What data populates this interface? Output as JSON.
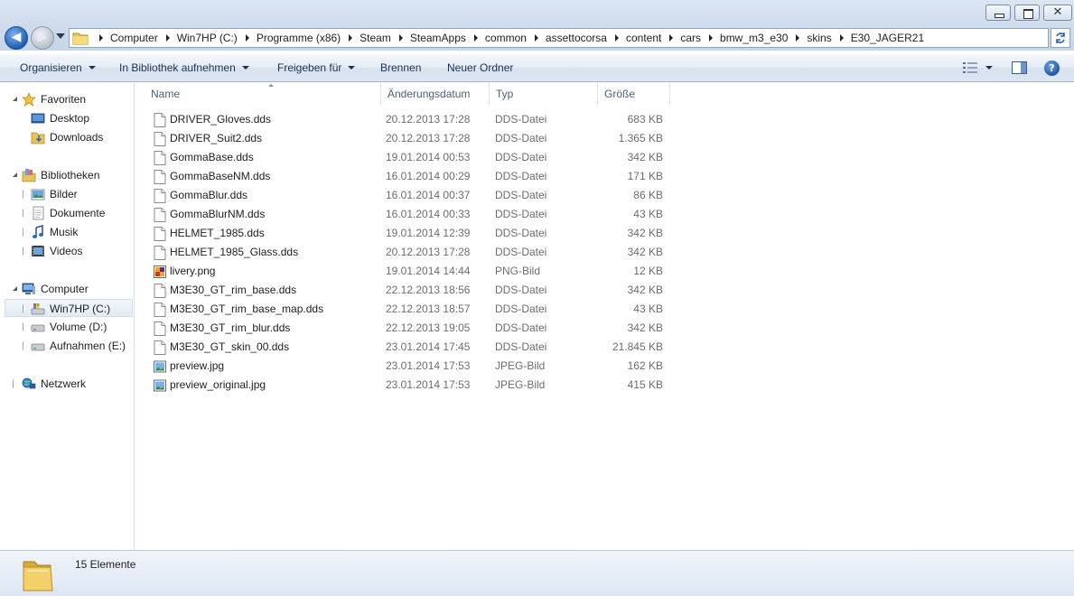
{
  "titlebar": {
    "minimize_icon": "minimize-icon",
    "maximize_icon": "maximize-icon",
    "close_glyph": "✕"
  },
  "address": {
    "crumbs": [
      "Computer",
      "Win7HP (C:)",
      "Programme (x86)",
      "Steam",
      "SteamApps",
      "common",
      "assettocorsa",
      "content",
      "cars",
      "bmw_m3_e30",
      "skins",
      "E30_JAGER21"
    ]
  },
  "toolbar": {
    "organize": "Organisieren",
    "include_library": "In Bibliothek aufnehmen",
    "share": "Freigeben für",
    "burn": "Brennen",
    "new_folder": "Neuer Ordner",
    "help_glyph": "?"
  },
  "nav": {
    "favorites": "Favoriten",
    "desktop": "Desktop",
    "downloads": "Downloads",
    "libraries": "Bibliotheken",
    "pictures": "Bilder",
    "documents": "Dokumente",
    "music": "Musik",
    "videos": "Videos",
    "computer": "Computer",
    "drive_c": "Win7HP (C:)",
    "drive_d": "Volume (D:)",
    "drive_e": "Aufnahmen (E:)",
    "network": "Netzwerk"
  },
  "columns": {
    "name": "Name",
    "date": "Änderungsdatum",
    "type": "Typ",
    "size": "Größe"
  },
  "files": [
    {
      "name": "DRIVER_Gloves.dds",
      "date": "20.12.2013 17:28",
      "type": "DDS-Datei",
      "size": "683 KB",
      "icon": "dds"
    },
    {
      "name": "DRIVER_Suit2.dds",
      "date": "20.12.2013 17:28",
      "type": "DDS-Datei",
      "size": "1.365 KB",
      "icon": "dds"
    },
    {
      "name": "GommaBase.dds",
      "date": "19.01.2014 00:53",
      "type": "DDS-Datei",
      "size": "342 KB",
      "icon": "dds"
    },
    {
      "name": "GommaBaseNM.dds",
      "date": "16.01.2014 00:29",
      "type": "DDS-Datei",
      "size": "171 KB",
      "icon": "dds"
    },
    {
      "name": "GommaBlur.dds",
      "date": "16.01.2014 00:37",
      "type": "DDS-Datei",
      "size": "86 KB",
      "icon": "dds"
    },
    {
      "name": "GommaBlurNM.dds",
      "date": "16.01.2014 00:33",
      "type": "DDS-Datei",
      "size": "43 KB",
      "icon": "dds"
    },
    {
      "name": "HELMET_1985.dds",
      "date": "19.01.2014 12:39",
      "type": "DDS-Datei",
      "size": "342 KB",
      "icon": "dds"
    },
    {
      "name": "HELMET_1985_Glass.dds",
      "date": "20.12.2013 17:28",
      "type": "DDS-Datei",
      "size": "342 KB",
      "icon": "dds"
    },
    {
      "name": "livery.png",
      "date": "19.01.2014 14:44",
      "type": "PNG-Bild",
      "size": "12 KB",
      "icon": "png"
    },
    {
      "name": "M3E30_GT_rim_base.dds",
      "date": "22.12.2013 18:56",
      "type": "DDS-Datei",
      "size": "342 KB",
      "icon": "dds"
    },
    {
      "name": "M3E30_GT_rim_base_map.dds",
      "date": "22.12.2013 18:57",
      "type": "DDS-Datei",
      "size": "43 KB",
      "icon": "dds"
    },
    {
      "name": "M3E30_GT_rim_blur.dds",
      "date": "22.12.2013 19:05",
      "type": "DDS-Datei",
      "size": "342 KB",
      "icon": "dds"
    },
    {
      "name": "M3E30_GT_skin_00.dds",
      "date": "23.01.2014 17:45",
      "type": "DDS-Datei",
      "size": "21.845 KB",
      "icon": "dds"
    },
    {
      "name": "preview.jpg",
      "date": "23.01.2014 17:53",
      "type": "JPEG-Bild",
      "size": "162 KB",
      "icon": "jpg"
    },
    {
      "name": "preview_original.jpg",
      "date": "23.01.2014 17:53",
      "type": "JPEG-Bild",
      "size": "415 KB",
      "icon": "jpg"
    }
  ],
  "status": {
    "item_count": "15 Elemente"
  },
  "colors": {
    "accent": "#1f5fb5",
    "text": "#1e1e1e",
    "muted": "#6d6d6d",
    "header_text": "#4c607a"
  }
}
